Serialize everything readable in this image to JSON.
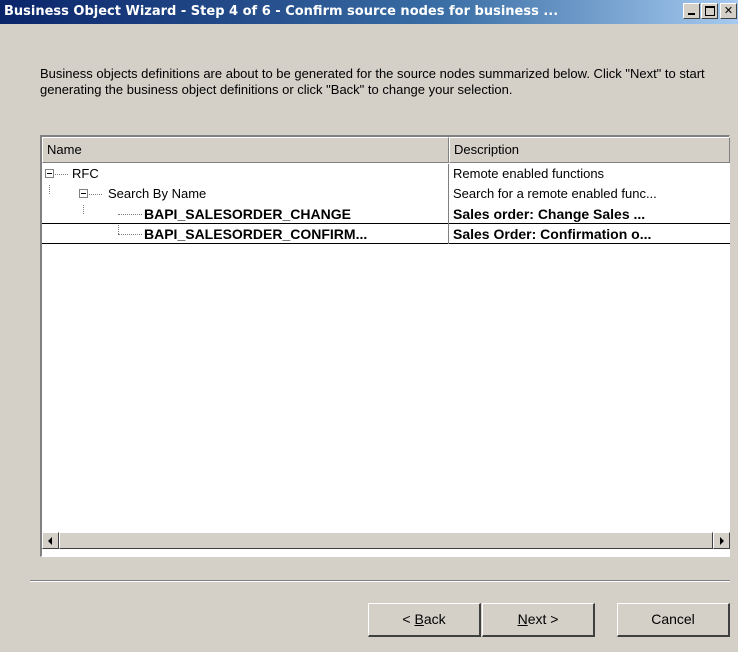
{
  "window": {
    "title": "Business Object Wizard - Step 4 of 6 - Confirm source nodes for business ..."
  },
  "intro": {
    "text": "Business objects definitions are about to be generated for the source nodes summarized below. Click \"Next\" to start generating the business object definitions or click \"Back\" to change your selection."
  },
  "tree": {
    "columns": [
      "Name",
      "Description"
    ],
    "rows": [
      {
        "name": "RFC",
        "description": "Remote enabled functions",
        "bold": false
      },
      {
        "name": "Search By Name",
        "description": "Search for a remote enabled func...",
        "bold": false
      },
      {
        "name": "BAPI_SALESORDER_CHANGE",
        "description": "Sales order: Change Sales ...",
        "bold": true
      },
      {
        "name": "BAPI_SALESORDER_CONFIRM...",
        "description": "Sales Order: Confirmation o...",
        "bold": true
      }
    ]
  },
  "buttons": {
    "back_prefix": "< ",
    "back_accel": "B",
    "back_rest": "ack",
    "next_accel": "N",
    "next_rest": "ext >",
    "cancel": "Cancel"
  },
  "icons": {
    "minimize": "minimize-icon",
    "maximize": "maximize-icon",
    "close": "close-icon",
    "collapse": "minus-box-icon",
    "scroll_left": "arrow-left-icon",
    "scroll_right": "arrow-right-icon"
  }
}
